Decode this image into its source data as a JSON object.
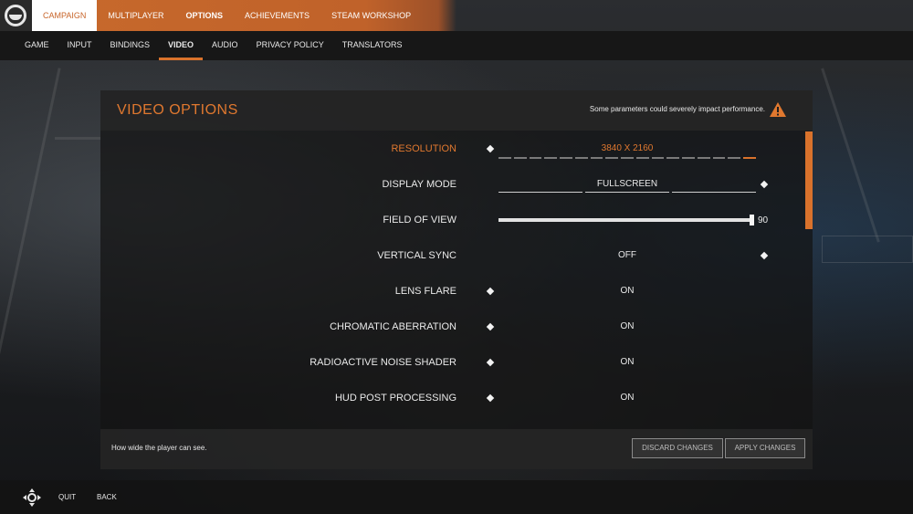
{
  "main_nav": {
    "tabs": [
      {
        "label": "CAMPAIGN"
      },
      {
        "label": "MULTIPLAYER"
      },
      {
        "label": "OPTIONS"
      },
      {
        "label": "ACHIEVEMENTS"
      },
      {
        "label": "STEAM WORKSHOP"
      }
    ],
    "active": "OPTIONS"
  },
  "sub_nav": {
    "tabs": [
      {
        "label": "GAME"
      },
      {
        "label": "INPUT"
      },
      {
        "label": "BINDINGS"
      },
      {
        "label": "VIDEO"
      },
      {
        "label": "AUDIO"
      },
      {
        "label": "PRIVACY POLICY"
      },
      {
        "label": "TRANSLATORS"
      }
    ],
    "active": "VIDEO"
  },
  "panel": {
    "title": "VIDEO OPTIONS",
    "performance_note": "Some parameters could severely impact performance.",
    "options": [
      {
        "label": "RESOLUTION",
        "value": "3840 X 2160",
        "selected_step": 17,
        "total_steps": 17
      },
      {
        "label": "DISPLAY MODE",
        "value": "FULLSCREEN"
      },
      {
        "label": "FIELD OF VIEW",
        "value": "90",
        "fraction": 1.0
      },
      {
        "label": "VERTICAL SYNC",
        "value": "OFF"
      },
      {
        "label": "LENS FLARE",
        "value": "ON"
      },
      {
        "label": "CHROMATIC ABERRATION",
        "value": "ON"
      },
      {
        "label": "RADIOACTIVE NOISE SHADER",
        "value": "ON"
      },
      {
        "label": "HUD POST PROCESSING",
        "value": "ON"
      }
    ],
    "hint": "How wide the player can see.",
    "discard_label": "DISCARD CHANGES",
    "apply_label": "APPLY CHANGES"
  },
  "bottom_bar": {
    "quit_label": "QUIT",
    "back_label": "BACK"
  },
  "colors": {
    "accent": "#d9722c"
  },
  "icons": {
    "logo": "lambda-logo-icon",
    "warning": "warning-triangle-icon",
    "dpad": "dpad-icon"
  }
}
